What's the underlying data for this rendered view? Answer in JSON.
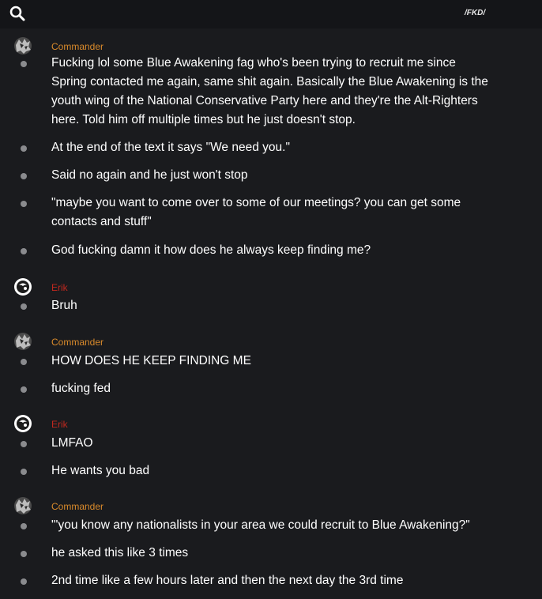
{
  "header": {
    "channel": "/FKD/"
  },
  "colors": {
    "commander": "#d98a2b",
    "erik": "#c0281e",
    "background": "#1a1b1e",
    "bullet": "#8a8b8e"
  },
  "groups": [
    {
      "author": "Commander",
      "messages": [
        "Fucking lol some Blue Awakening fag who's been trying to recruit me since Spring contacted me again, same shit again. Basically the Blue Awakening is the youth wing of the National Conservative Party here and they're the Alt-Righters here. Told him off multiple times but he just doesn't stop.",
        "At the end of the text it says \"We need you.\"",
        "Said no again and he just won't stop",
        "\"maybe you want to come over to some of our meetings? you can get some contacts and stuff\"",
        "God fucking damn it how does he always keep finding me?"
      ]
    },
    {
      "author": "Erik",
      "messages": [
        "Bruh"
      ]
    },
    {
      "author": "Commander",
      "messages": [
        "HOW DOES HE KEEP FINDING ME",
        "fucking fed"
      ]
    },
    {
      "author": "Erik",
      "messages": [
        "LMFAO",
        "He wants you bad"
      ]
    },
    {
      "author": "Commander",
      "messages": [
        "\"'you know any nationalists in your area we could recruit to Blue Awakening?\"",
        "he asked this like 3 times",
        "2nd time like a few hours later and then the next day the 3rd time"
      ]
    }
  ]
}
